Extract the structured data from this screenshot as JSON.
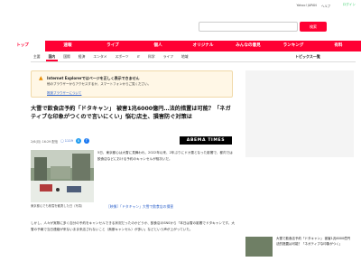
{
  "topbar": {
    "links": [
      "Yahoo! JAPAN",
      "ヘルプ"
    ],
    "login": "ログイン"
  },
  "search": {
    "placeholder": "",
    "button": "検索"
  },
  "nav": {
    "items": [
      "トップ",
      "速報",
      "ライブ",
      "個人",
      "オリジナル",
      "みんなの意見",
      "ランキング",
      "有料"
    ],
    "active_index": 0
  },
  "subnav": {
    "items": [
      "主要",
      "国内",
      "国際",
      "経済",
      "エンタメ",
      "スポーツ",
      "IT",
      "科学",
      "ライフ",
      "地域"
    ],
    "active_index": 1,
    "right_label": "トピックス一覧"
  },
  "warning": {
    "title": "Internet Explorerではページを正しく表示できません",
    "body": "他のブラウザーからアクセスするか、スマートフォンからご覧ください。",
    "link": "推奨ブラウザーについて"
  },
  "article": {
    "headline": "大雪で飲食店予約「ドタキャン」 被害1兆6000億円…法的措置は可能？「ネガティブな印象がつくので言いにくい」悩む店主、損害防ぐ対策は",
    "date": "2/6(月) 16:29 配信",
    "comments": "1119",
    "source_badge": "ABEMA TIMES",
    "photo_caption": "東京都心でも積雪を観測した日（写真）",
    "body_1": "5日、東京都心は大雪に見舞われ、2022年以来、2年ぶりにドカ雪となった影響で、都内では飲食店などにおける予約のキャンセルが相次いだ。",
    "related": "［映像］「ドタキャン」大雪で飲食店の損害",
    "body_2": "しかし、人々が実際に多く自分の予約をキャンセルできる状況だったのかどうか、飲食店のSNSから「本日は雪の影響でドタキャンです。大雪の予報で当日連絡が来ないまま来店されないこと（無断キャンセル）が多い」などという声が上がっていた。"
  },
  "sidebar": {
    "heading": "",
    "item_text": "大雪で飲食店予約「ドタキャン」 被害1兆6000億円 法的措置は可能？「ネガティブな印象がつく」"
  },
  "colors": {
    "brand": "#ff0033",
    "link": "#3366cc",
    "warning_bg": "#fff7e6"
  }
}
